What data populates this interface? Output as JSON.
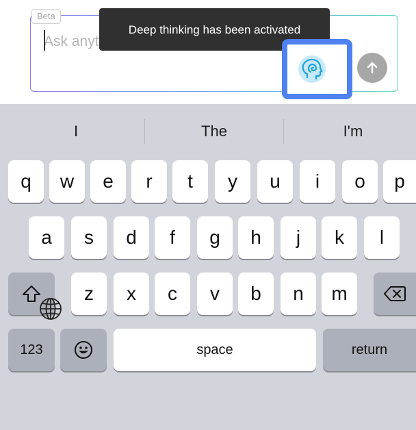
{
  "composer": {
    "badge": "Beta",
    "placeholder": "Ask anything",
    "tooltip": "Deep thinking has been activated"
  },
  "keyboard": {
    "suggestions": [
      "I",
      "The",
      "I'm"
    ],
    "row1": [
      "q",
      "w",
      "e",
      "r",
      "t",
      "y",
      "u",
      "i",
      "o",
      "p"
    ],
    "row2": [
      "a",
      "s",
      "d",
      "f",
      "g",
      "h",
      "j",
      "k",
      "l"
    ],
    "row3": [
      "z",
      "x",
      "c",
      "v",
      "b",
      "n",
      "m"
    ],
    "numbers_key": "123",
    "space_key": "space",
    "return_key": "return"
  },
  "colors": {
    "highlight": "#4f82f1",
    "think_icon": "#1ea3d9",
    "send_button": "#a7a7a7",
    "keyboard_bg": "#d2d4db"
  },
  "icons": {
    "think": "brain-head-icon",
    "send": "arrow-up-icon",
    "shift": "shift-icon",
    "backspace": "backspace-icon",
    "emoji": "emoji-icon",
    "globe": "globe-icon"
  }
}
